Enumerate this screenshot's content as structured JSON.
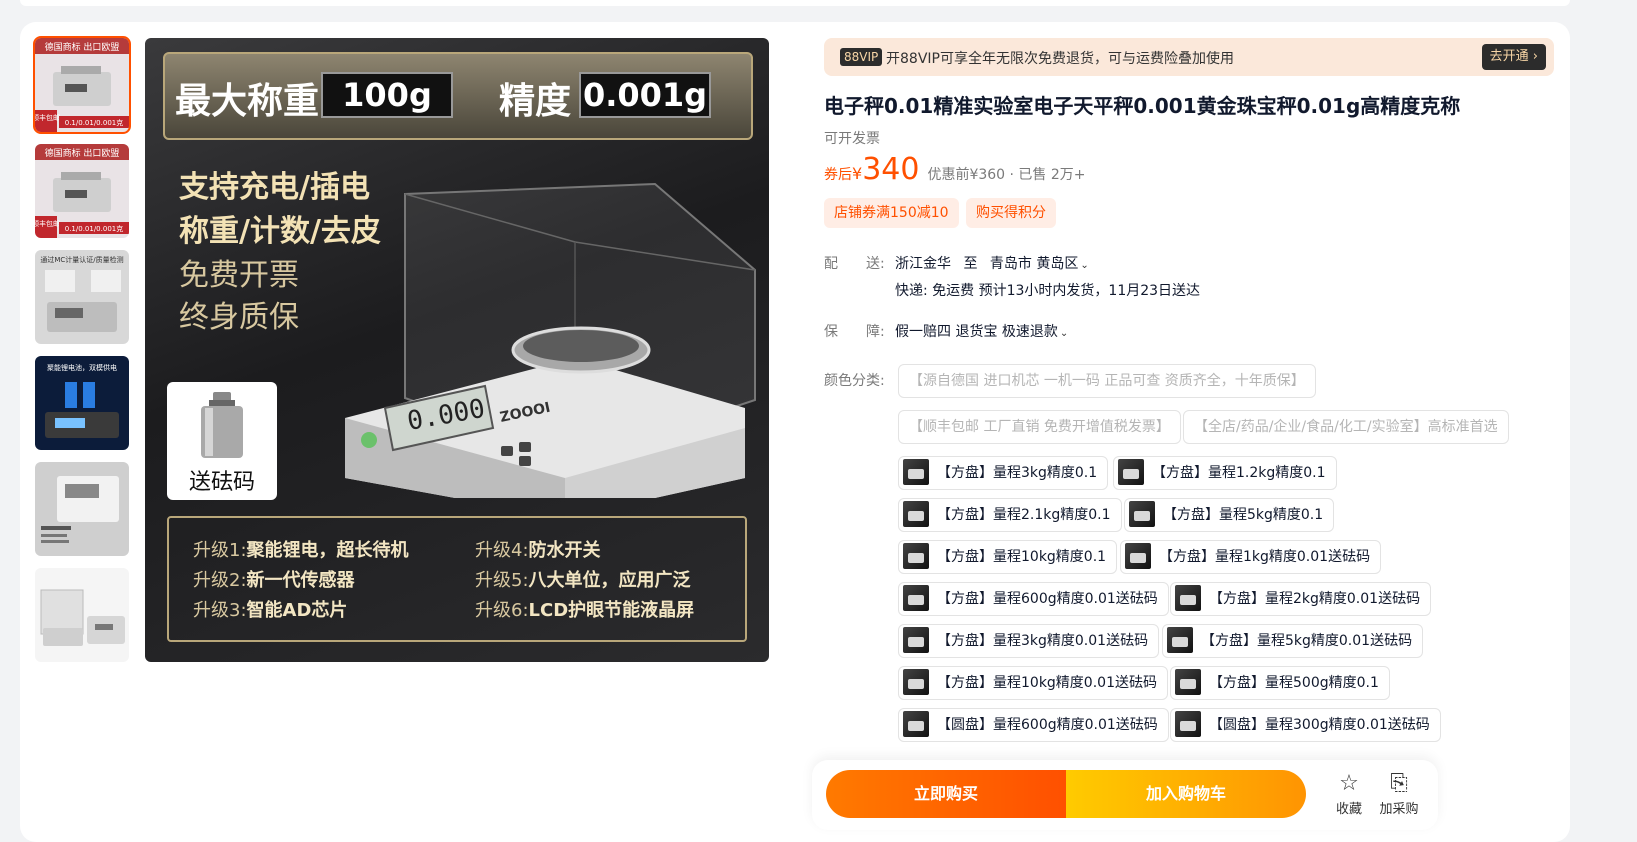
{
  "gallery": {
    "thumbs": [
      {
        "top_label": "德国商标 出口欧盟",
        "badge": "顺丰包邮",
        "caption": "0.1/0.01/0.001克"
      },
      {
        "top_label": "德国商标 出口欧盟",
        "badge": "顺丰包邮",
        "caption": "0.1/0.01/0.001克"
      },
      {
        "top_label": "通过MC计量认证/质量检测"
      },
      {
        "top_label": "聚能锂电池，双模供电"
      },
      {
        "top_label": ""
      },
      {
        "top_label": ""
      }
    ],
    "main": {
      "spec1_label": "最大称重",
      "spec1_value": "100g",
      "spec2_label": "精度",
      "spec2_value": "0.001g",
      "features": [
        "支持充电/插电",
        "称重/计数/去皮",
        "免费开票",
        "终身质保"
      ],
      "gift": "送砝码",
      "display_reading": "0.000",
      "brand": "ZOOOI",
      "upgrades": [
        {
          "k": "升级1:",
          "v": "聚能锂电，超长待机"
        },
        {
          "k": "升级2:",
          "v": "新一代传感器"
        },
        {
          "k": "升级3:",
          "v": "智能AD芯片"
        },
        {
          "k": "升级4:",
          "v": "防水开关"
        },
        {
          "k": "升级5:",
          "v": "八大单位，应用广泛"
        },
        {
          "k": "升级6:",
          "v": "LCD护眼节能液晶屏"
        }
      ]
    }
  },
  "vip": {
    "badge": "88VIP",
    "text": "开88VIP可享全年无限次免费退货，可与运费险叠加使用",
    "button": "去开通 ›"
  },
  "product": {
    "title": "电子秤0.01精准实验室电子天平秤0.001黄金珠宝秤0.01g高精度克称",
    "invoice": "可开发票",
    "price_prefix": "券后",
    "price_yen": "¥",
    "price": "340",
    "price_original": "优惠前¥360 · 已售 2万+",
    "tags": [
      "店铺券满150减10",
      "购买得积分"
    ]
  },
  "delivery": {
    "label": "配　　送:",
    "from": "浙江金华",
    "to_word": "至",
    "to": "青岛市 黄岛区",
    "detail": "快递: 免运费  预计13小时内发货，11月23日送达"
  },
  "guarantee": {
    "label": "保　　障:",
    "value": "假一赔四 退货宝 极速退款"
  },
  "sku": {
    "label": "颜色分类:",
    "text_options": [
      "【源自德国 进口机芯 一机一码 正品可查 资质齐全，十年质保】",
      "【顺丰包邮 工厂直销 免费开增值税发票】",
      "【全店/药品/企业/食品/化工/实验室】高标准首选"
    ],
    "options": [
      "【方盘】量程3kg精度0.1",
      "【方盘】量程1.2kg精度0.1",
      "【方盘】量程2.1kg精度0.1",
      "【方盘】量程5kg精度0.1",
      "【方盘】量程10kg精度0.1",
      "【方盘】量程1kg精度0.01送砝码",
      "【方盘】量程600g精度0.01送砝码",
      "【方盘】量程2kg精度0.01送砝码",
      "【方盘】量程3kg精度0.01送砝码",
      "【方盘】量程5kg精度0.01送砝码",
      "【方盘】量程10kg精度0.01送砝码",
      "【方盘】量程500g精度0.1",
      "【圆盘】量程600g精度0.01送砝码",
      "【圆盘】量程300g精度0.01送砝码"
    ]
  },
  "actions": {
    "buy": "立即购买",
    "cart": "加入购物车",
    "favorite": "收藏",
    "purchase": "加采购"
  }
}
